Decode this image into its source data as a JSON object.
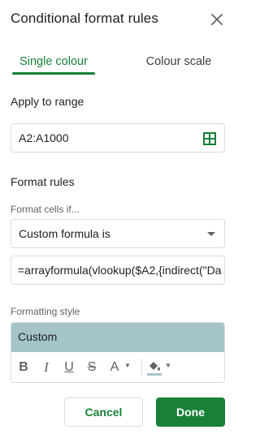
{
  "panel": {
    "title": "Conditional format rules"
  },
  "tabs": [
    {
      "label": "Single colour",
      "active": true
    },
    {
      "label": "Colour scale",
      "active": false
    }
  ],
  "range": {
    "section_label": "Apply to range",
    "value": "A2:A1000"
  },
  "rules": {
    "section_label": "Format rules",
    "condition_label": "Format cells if...",
    "condition_value": "Custom formula is",
    "formula_value": "=arrayformula(vlookup($A2,{indirect(\"Da"
  },
  "formatting": {
    "label": "Formatting style",
    "preview_text": "Custom",
    "preview_color": "#a5c4c9",
    "tools": [
      "bold-icon",
      "italic-icon",
      "underline-icon",
      "strikethrough-icon",
      "text-color-icon",
      "fill-color-icon"
    ]
  },
  "buttons": {
    "cancel": "Cancel",
    "done": "Done"
  },
  "colors": {
    "accent": "#188038"
  }
}
